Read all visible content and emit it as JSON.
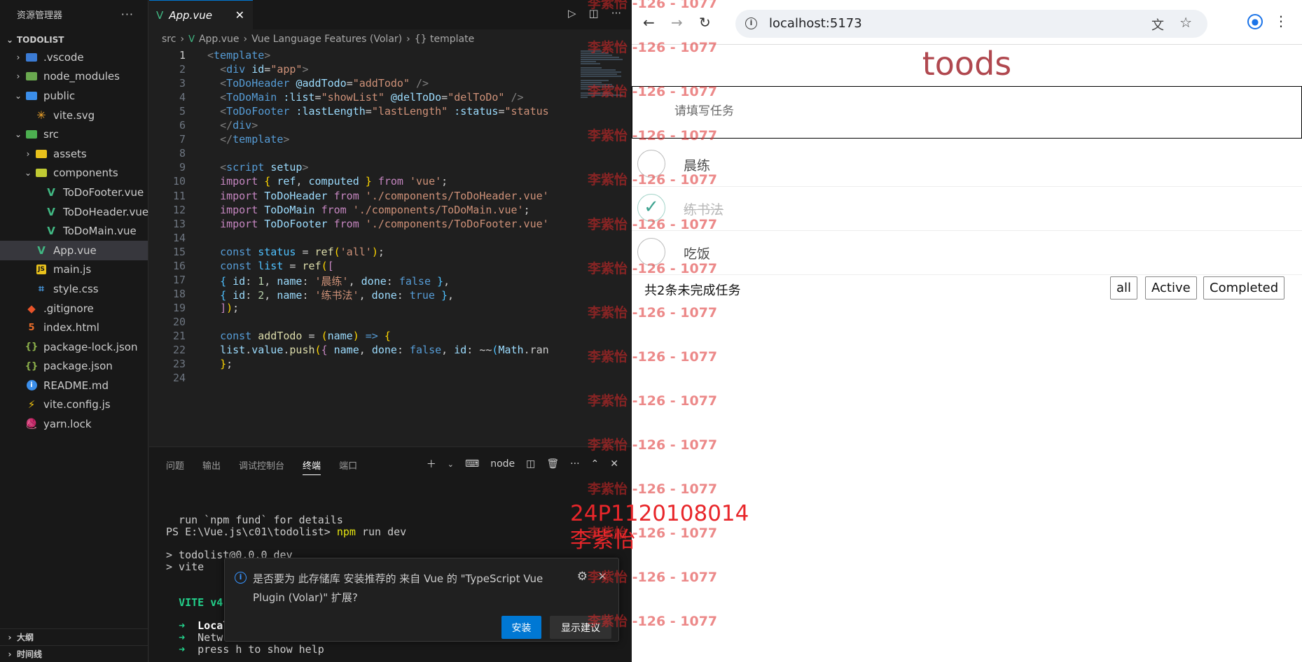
{
  "explorer": {
    "title": "资源管理器",
    "more": "···",
    "root": "TODOLIST",
    "items": [
      {
        "label": ".vscode",
        "chev": "›",
        "indent": 1,
        "icon": "vscode-folder",
        "color": "#3b7bd4"
      },
      {
        "label": "node_modules",
        "chev": "›",
        "indent": 1,
        "icon": "node-folder",
        "color": "#6aa84f"
      },
      {
        "label": "public",
        "chev": "⌄",
        "indent": 1,
        "icon": "public-folder",
        "color": "#3b8eea"
      },
      {
        "label": "vite.svg",
        "chev": "",
        "indent": 2,
        "icon": "star-icon"
      },
      {
        "label": "src",
        "chev": "⌄",
        "indent": 1,
        "icon": "src-folder",
        "color": "#4caf50"
      },
      {
        "label": "assets",
        "chev": "›",
        "indent": 2,
        "icon": "assets-folder",
        "color": "#e8c11c"
      },
      {
        "label": "components",
        "chev": "⌄",
        "indent": 2,
        "icon": "components-folder",
        "color": "#c0ca33"
      },
      {
        "label": "ToDoFooter.vue",
        "chev": "",
        "indent": 3,
        "icon": "vue-icon"
      },
      {
        "label": "ToDoHeader.vue",
        "chev": "",
        "indent": 3,
        "icon": "vue-icon"
      },
      {
        "label": "ToDoMain.vue",
        "chev": "",
        "indent": 3,
        "icon": "vue-icon"
      },
      {
        "label": "App.vue",
        "chev": "",
        "indent": 2,
        "icon": "vue-icon",
        "selected": true
      },
      {
        "label": "main.js",
        "chev": "",
        "indent": 2,
        "icon": "js-icon"
      },
      {
        "label": "style.css",
        "chev": "",
        "indent": 2,
        "icon": "css-icon"
      },
      {
        "label": ".gitignore",
        "chev": "",
        "indent": 1,
        "icon": "git-icon"
      },
      {
        "label": "index.html",
        "chev": "",
        "indent": 1,
        "icon": "html-icon"
      },
      {
        "label": "package-lock.json",
        "chev": "",
        "indent": 1,
        "icon": "json-icon"
      },
      {
        "label": "package.json",
        "chev": "",
        "indent": 1,
        "icon": "json-icon"
      },
      {
        "label": "README.md",
        "chev": "",
        "indent": 1,
        "icon": "info-icon"
      },
      {
        "label": "vite.config.js",
        "chev": "",
        "indent": 1,
        "icon": "bolt-icon"
      },
      {
        "label": "yarn.lock",
        "chev": "",
        "indent": 1,
        "icon": "yarn-icon"
      }
    ],
    "outline": "大纲",
    "timeline": "时间线"
  },
  "editor": {
    "tab": "App.vue",
    "tab_close": "✕",
    "breadcrumb": [
      "src",
      "App.vue",
      "Vue Language Features (Volar)",
      "{} template"
    ],
    "current_line": 1,
    "lines": [
      [
        [
          "tg",
          "<"
        ],
        [
          "tn",
          "template"
        ],
        [
          "tg",
          ">"
        ]
      ],
      [
        [
          "",
          "  "
        ],
        [
          "tg",
          "<"
        ],
        [
          "tn",
          "div"
        ],
        [
          "",
          " "
        ],
        [
          "at",
          "id"
        ],
        [
          "",
          "="
        ],
        [
          "st",
          "\"app\""
        ],
        [
          "tg",
          ">"
        ]
      ],
      [
        [
          "",
          "  "
        ],
        [
          "tg",
          "<"
        ],
        [
          "tn",
          "ToDoHeader"
        ],
        [
          "",
          " "
        ],
        [
          "at",
          "@addTodo"
        ],
        [
          "",
          "="
        ],
        [
          "st",
          "\"addTodo\""
        ],
        [
          "",
          " "
        ],
        [
          "tg",
          "/>"
        ]
      ],
      [
        [
          "",
          "  "
        ],
        [
          "tg",
          "<"
        ],
        [
          "tn",
          "ToDoMain"
        ],
        [
          "",
          " "
        ],
        [
          "at",
          ":list"
        ],
        [
          "",
          "="
        ],
        [
          "st",
          "\"showList\""
        ],
        [
          "",
          " "
        ],
        [
          "at",
          "@delToDo"
        ],
        [
          "",
          "="
        ],
        [
          "st",
          "\"delToDo\""
        ],
        [
          "",
          " "
        ],
        [
          "tg",
          "/>"
        ]
      ],
      [
        [
          "",
          "  "
        ],
        [
          "tg",
          "<"
        ],
        [
          "tn",
          "ToDoFooter"
        ],
        [
          "",
          " "
        ],
        [
          "at",
          ":lastLength"
        ],
        [
          "",
          "="
        ],
        [
          "st",
          "\"lastLength\""
        ],
        [
          "",
          " "
        ],
        [
          "at",
          ":status"
        ],
        [
          "",
          "="
        ],
        [
          "st",
          "\"status"
        ]
      ],
      [
        [
          "",
          "  "
        ],
        [
          "tg",
          "</"
        ],
        [
          "tn",
          "div"
        ],
        [
          "tg",
          ">"
        ]
      ],
      [
        [
          "",
          "  "
        ],
        [
          "tg",
          "</"
        ],
        [
          "tn",
          "template"
        ],
        [
          "tg",
          ">"
        ]
      ],
      [],
      [
        [
          "",
          "  "
        ],
        [
          "tg",
          "<"
        ],
        [
          "tn",
          "script"
        ],
        [
          "",
          " "
        ],
        [
          "at",
          "setup"
        ],
        [
          "tg",
          ">"
        ]
      ],
      [
        [
          "",
          "  "
        ],
        [
          "kw",
          "import"
        ],
        [
          "",
          " "
        ],
        [
          "br",
          "{"
        ],
        [
          "",
          " "
        ],
        [
          "vr",
          "ref"
        ],
        [
          "",
          ", "
        ],
        [
          "vr",
          "computed"
        ],
        [
          "",
          " "
        ],
        [
          "br",
          "}"
        ],
        [
          "",
          " "
        ],
        [
          "kw",
          "from"
        ],
        [
          "",
          " "
        ],
        [
          "st",
          "'vue'"
        ],
        [
          "",
          ";"
        ]
      ],
      [
        [
          "",
          "  "
        ],
        [
          "kw",
          "import"
        ],
        [
          "",
          " "
        ],
        [
          "vr",
          "ToDoHeader"
        ],
        [
          "",
          " "
        ],
        [
          "kw",
          "from"
        ],
        [
          "",
          " "
        ],
        [
          "st",
          "'./components/ToDoHeader.vue'"
        ]
      ],
      [
        [
          "",
          "  "
        ],
        [
          "kw",
          "import"
        ],
        [
          "",
          " "
        ],
        [
          "vr",
          "ToDoMain"
        ],
        [
          "",
          " "
        ],
        [
          "kw",
          "from"
        ],
        [
          "",
          " "
        ],
        [
          "st",
          "'./components/ToDoMain.vue'"
        ],
        [
          "",
          ";"
        ]
      ],
      [
        [
          "",
          "  "
        ],
        [
          "kw",
          "import"
        ],
        [
          "",
          " "
        ],
        [
          "vr",
          "ToDoFooter"
        ],
        [
          "",
          " "
        ],
        [
          "kw",
          "from"
        ],
        [
          "",
          " "
        ],
        [
          "st",
          "'./components/ToDoFooter.vue'"
        ]
      ],
      [],
      [
        [
          "",
          "  "
        ],
        [
          "kb",
          "const"
        ],
        [
          "",
          " "
        ],
        [
          "cm",
          "status"
        ],
        [
          "",
          " = "
        ],
        [
          "fn",
          "ref"
        ],
        [
          "br",
          "("
        ],
        [
          "st",
          "'all'"
        ],
        [
          "br",
          ")"
        ],
        [
          "",
          ";"
        ]
      ],
      [
        [
          "",
          "  "
        ],
        [
          "kb",
          "const"
        ],
        [
          "",
          " "
        ],
        [
          "cm",
          "list"
        ],
        [
          "",
          " = "
        ],
        [
          "fn",
          "ref"
        ],
        [
          "br",
          "("
        ],
        [
          "kw",
          "["
        ]
      ],
      [
        [
          "",
          "  "
        ],
        [
          "cm",
          "{"
        ],
        [
          "",
          " "
        ],
        [
          "vr",
          "id"
        ],
        [
          "",
          ": "
        ],
        [
          "nm",
          "1"
        ],
        [
          "",
          ", "
        ],
        [
          "vr",
          "name"
        ],
        [
          "",
          ": "
        ],
        [
          "st",
          "'晨练'"
        ],
        [
          "",
          ", "
        ],
        [
          "vr",
          "done"
        ],
        [
          "",
          ": "
        ],
        [
          "kb",
          "false"
        ],
        [
          "",
          " "
        ],
        [
          "cm",
          "}"
        ],
        [
          "",
          ","
        ]
      ],
      [
        [
          "",
          "  "
        ],
        [
          "cm",
          "{"
        ],
        [
          "",
          " "
        ],
        [
          "vr",
          "id"
        ],
        [
          "",
          ": "
        ],
        [
          "nm",
          "2"
        ],
        [
          "",
          ", "
        ],
        [
          "vr",
          "name"
        ],
        [
          "",
          ": "
        ],
        [
          "st",
          "'练书法'"
        ],
        [
          "",
          ", "
        ],
        [
          "vr",
          "done"
        ],
        [
          "",
          ": "
        ],
        [
          "kb",
          "true"
        ],
        [
          "",
          " "
        ],
        [
          "cm",
          "}"
        ],
        [
          "",
          ","
        ]
      ],
      [
        [
          "",
          "  "
        ],
        [
          "kw",
          "]"
        ],
        [
          "br",
          ")"
        ],
        [
          "",
          ";"
        ]
      ],
      [],
      [
        [
          "",
          "  "
        ],
        [
          "kb",
          "const"
        ],
        [
          "",
          " "
        ],
        [
          "fn",
          "addTodo"
        ],
        [
          "",
          " = "
        ],
        [
          "br",
          "("
        ],
        [
          "vr",
          "name"
        ],
        [
          "br",
          ")"
        ],
        [
          "",
          " "
        ],
        [
          "kb",
          "=>"
        ],
        [
          "",
          " "
        ],
        [
          "br",
          "{"
        ]
      ],
      [
        [
          "",
          "  "
        ],
        [
          "vr",
          "list"
        ],
        [
          "",
          "."
        ],
        [
          "vr",
          "value"
        ],
        [
          "",
          "."
        ],
        [
          "fn",
          "push"
        ],
        [
          "br",
          "("
        ],
        [
          "kw",
          "{"
        ],
        [
          "",
          " "
        ],
        [
          "vr",
          "name"
        ],
        [
          "",
          ", "
        ],
        [
          "vr",
          "done"
        ],
        [
          "",
          ": "
        ],
        [
          "kb",
          "false"
        ],
        [
          "",
          ", "
        ],
        [
          "vr",
          "id"
        ],
        [
          "",
          ": ~~"
        ],
        [
          "cm",
          "("
        ],
        [
          "vr",
          "Math"
        ],
        [
          "",
          ".ran"
        ]
      ],
      [
        [
          "",
          "  "
        ],
        [
          "br",
          "}"
        ],
        [
          "",
          ";"
        ]
      ],
      []
    ]
  },
  "panel": {
    "tabs": [
      "问题",
      "输出",
      "调试控制台",
      "终端",
      "端口"
    ],
    "active_tab": "终端",
    "terminal_name": "node",
    "lines": [
      [
        [
          "",
          "  run `npm fund` for details"
        ]
      ],
      [
        [
          "",
          "PS E:\\Vue.js\\c01\\todolist> "
        ],
        [
          "y",
          "npm"
        ],
        [
          "",
          " run dev"
        ]
      ],
      [],
      [
        [
          "",
          "> todolist@0.0.0 dev"
        ]
      ],
      [
        [
          "",
          "> vite"
        ]
      ],
      [],
      [],
      [
        [
          "",
          "  "
        ],
        [
          "g",
          "VITE"
        ],
        [
          "g",
          " v4"
        ]
      ],
      [],
      [
        [
          "",
          "  "
        ],
        [
          "g",
          "➜"
        ],
        [
          "",
          ""
        ],
        [
          "w",
          "  Local"
        ]
      ],
      [
        [
          "",
          "  "
        ],
        [
          "g",
          "➜"
        ],
        [
          "",
          "  Netw"
        ]
      ],
      [
        [
          "",
          "  "
        ],
        [
          "g",
          "➜"
        ],
        [
          "",
          "  press h to show help"
        ]
      ]
    ]
  },
  "notification": {
    "text": "是否要为 此存储库 安装推荐的 来自 Vue 的 \"TypeScript Vue Plugin (Volar)\" 扩展?",
    "install": "安装",
    "show": "显示建议"
  },
  "browser": {
    "url": "localhost:5173",
    "app": {
      "title": "toods",
      "placeholder": "请填写任务",
      "todos": [
        {
          "name": "晨练",
          "done": false
        },
        {
          "name": "练书法",
          "done": true
        },
        {
          "name": "吃饭",
          "done": false
        }
      ],
      "remaining": "共2条未完成任务",
      "filters": [
        "all",
        "Active",
        "Completed"
      ]
    }
  },
  "watermark": {
    "text": "李紫怡 -126 - 1077",
    "stamp_id": "24P1120108014",
    "stamp_name": "李紫怡"
  },
  "colors": {
    "vue_green": "#41b883",
    "accent_blue": "#0078d4",
    "title_red": "#b0484f"
  }
}
